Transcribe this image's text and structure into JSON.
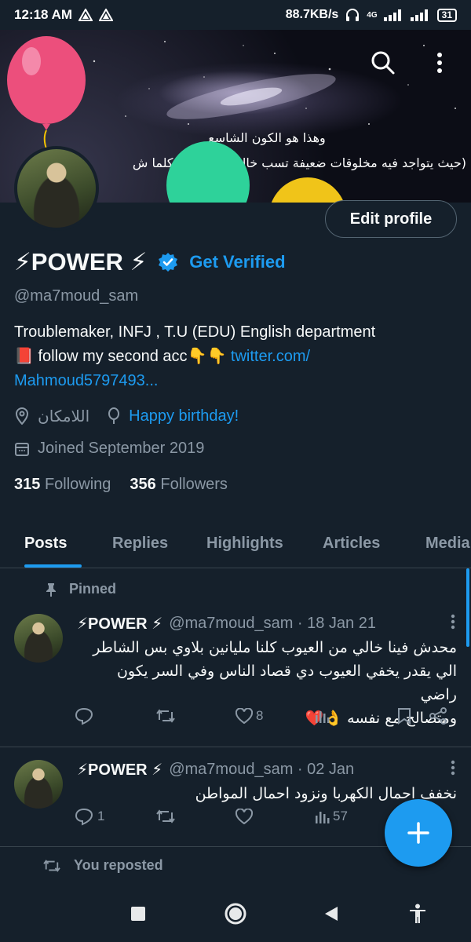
{
  "status_bar": {
    "time": "12:18 AM",
    "net_speed": "88.7KB/s",
    "network_type": "4G",
    "battery": "31"
  },
  "banner": {
    "line1": "وهذا هو الكون الشاسع",
    "line2": "(حيث يتواجد فيه مخلوقات ضعيفة تسب خالق هذا الكون كلما ش"
  },
  "profile": {
    "name": "⚡POWER ⚡",
    "get_verified_label": "Get Verified",
    "handle": "@ma7moud_sam",
    "bio_line1": "Troublemaker, INFJ , T.U (EDU) English department",
    "bio_line2_text": "📕 follow my second acc👇👇 ",
    "bio_link_part1": "twitter.com/",
    "bio_link_part2": "Mahmoud5797493...",
    "location": "اللامكان",
    "birthday": "Happy birthday!",
    "joined": "Joined September 2019",
    "following_count": "315",
    "following_label": "Following",
    "followers_count": "356",
    "followers_label": "Followers",
    "edit_profile_label": "Edit profile"
  },
  "tabs": [
    "Posts",
    "Replies",
    "Highlights",
    "Articles",
    "Media"
  ],
  "pinned_label": "Pinned",
  "reposted_label": "You reposted",
  "tweets": [
    {
      "name": "⚡POWER ⚡",
      "meta": "@ma7moud_sam · 18 Jan 21",
      "body_line1": "محدش فينا خالي من العيوب كلنا مليانين بلاوي بس الشاطر",
      "body_line2": "الي يقدر يخفي العيوب دي قصاد الناس وفي السر يكون راضي",
      "body_line3": "ومتصالح مع نفسه 👌❤️",
      "likes": "8"
    },
    {
      "name": "⚡POWER ⚡",
      "meta": "@ma7moud_sam · 02 Jan",
      "body_line1": "نخفف احمال الكهربا ونزود احمال المواطن",
      "replies": "1",
      "views": "57"
    }
  ],
  "colors": {
    "background": "#15202b",
    "accent": "#1d9bf0",
    "muted": "#8b98a5",
    "divider": "#38444d"
  }
}
